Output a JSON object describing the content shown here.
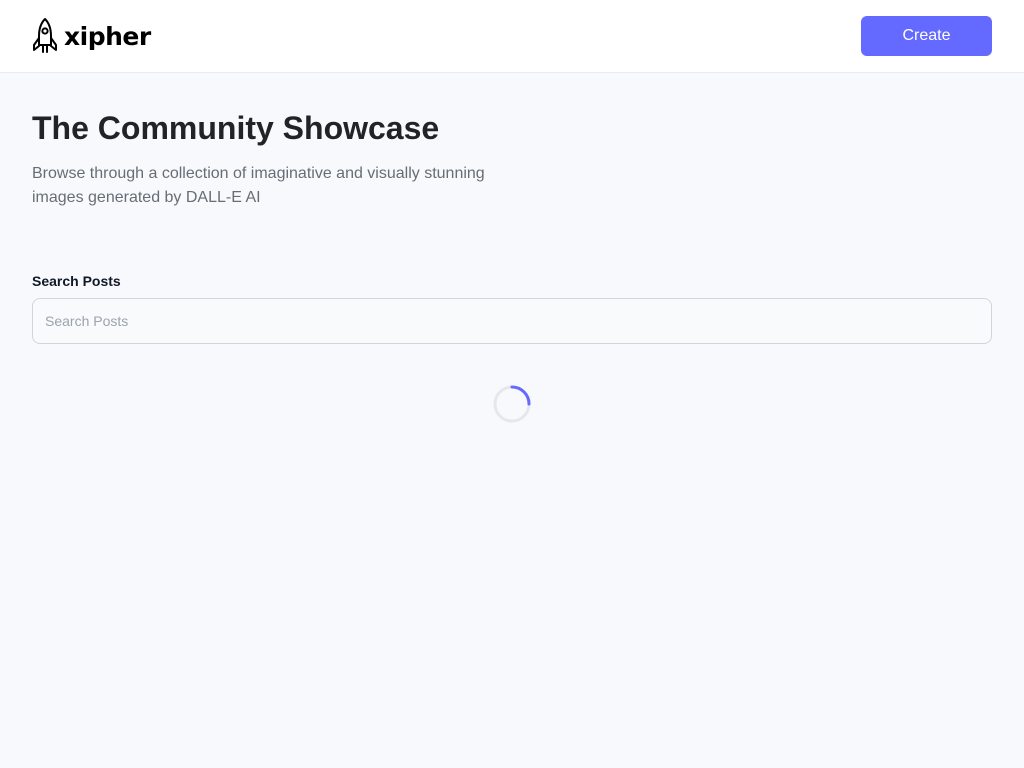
{
  "header": {
    "brand": "xipher",
    "create_label": "Create",
    "create_color": "#6469ff"
  },
  "main": {
    "title": "The Community Showcase",
    "subtitle": "Browse through a collection of imaginative and visually stunning images generated by DALL-E AI",
    "search": {
      "label": "Search Posts",
      "placeholder": "Search Posts",
      "value": ""
    }
  },
  "icons": {
    "logo": "rocket-icon",
    "loader": "loading-spinner"
  }
}
